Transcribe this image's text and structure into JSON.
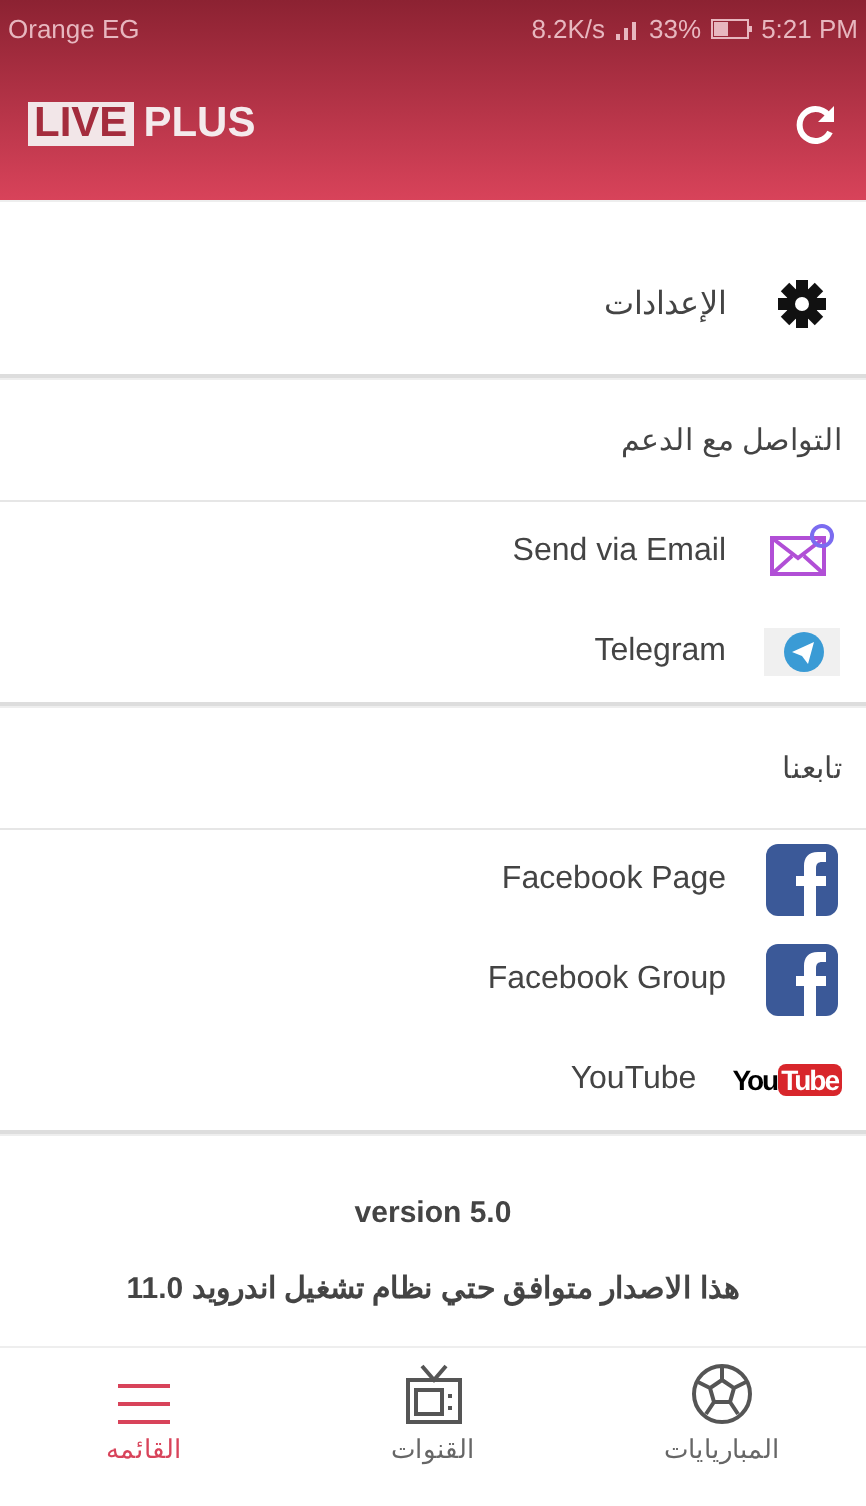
{
  "status_bar": {
    "carrier": "Orange EG",
    "speed": "8.2K/s",
    "battery": "33%",
    "time": "5:21 PM"
  },
  "app_bar": {
    "logo_box": "LIVE",
    "logo_text": "PLUS"
  },
  "settings": {
    "label": "الإعدادات"
  },
  "sections": [
    {
      "title": "التواصل مع الدعم",
      "items": [
        {
          "kind": "email",
          "label": "Send via Email"
        },
        {
          "kind": "telegram",
          "label": "Telegram"
        }
      ]
    },
    {
      "title": "تابعنا",
      "items": [
        {
          "kind": "facebook",
          "label": "Facebook Page"
        },
        {
          "kind": "facebook",
          "label": "Facebook Group"
        },
        {
          "kind": "youtube",
          "label": "YouTube",
          "logo_plain": "You",
          "logo_badge": "Tube"
        }
      ]
    }
  ],
  "version": "version 5.0",
  "compat_note": "هذا الاصدار متوافق حتي نظام تشغيل اندرويد 11.0",
  "bottom_nav": [
    {
      "kind": "ball",
      "label": "المباريايات",
      "selected": false
    },
    {
      "kind": "tv",
      "label": "القنوات",
      "selected": false
    },
    {
      "kind": "menu",
      "label": "القائمه",
      "selected": true
    }
  ]
}
